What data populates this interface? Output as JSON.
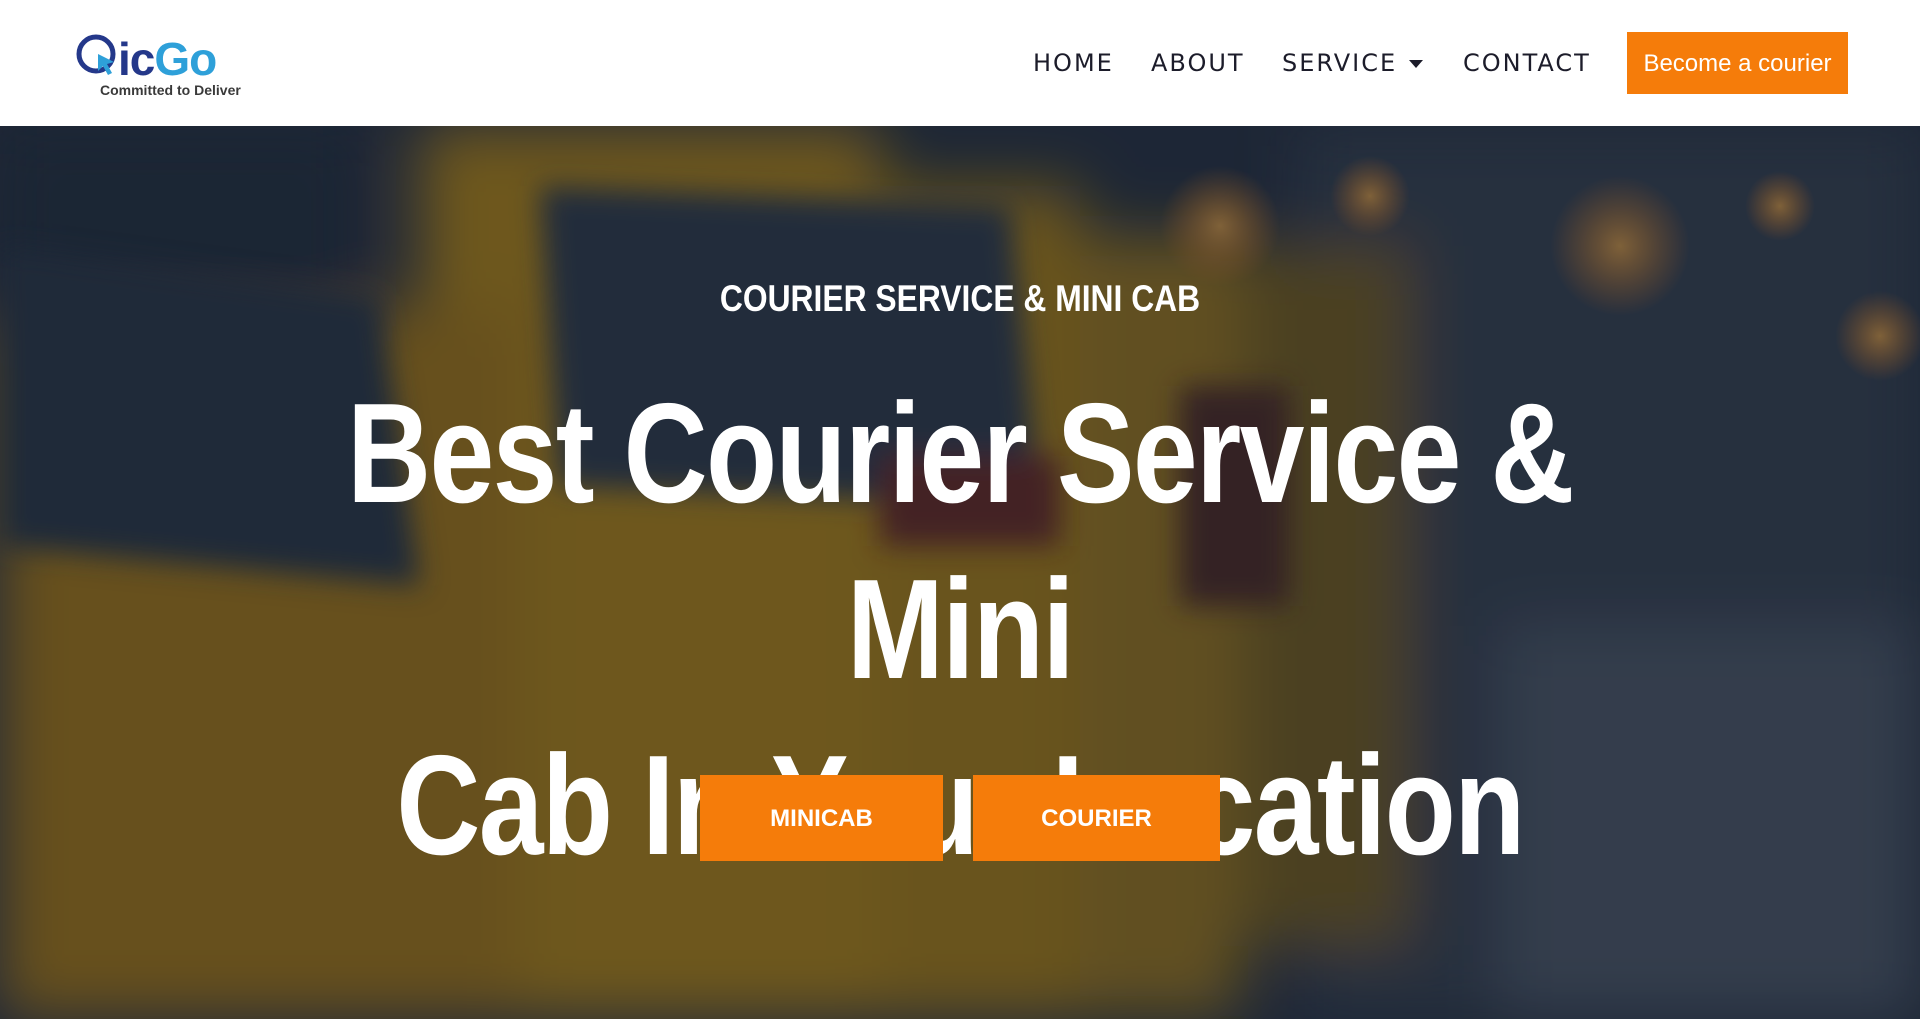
{
  "brand": {
    "logo_text_ic": "icGo",
    "tagline": "Committed to Deliver"
  },
  "nav": {
    "items": [
      {
        "label": "HOME"
      },
      {
        "label": "ABOUT"
      },
      {
        "label": "SERVICE"
      },
      {
        "label": "CONTACT"
      }
    ],
    "cta_label": "Become a courier"
  },
  "hero": {
    "kicker": "COURIER SERVICE & MINI CAB",
    "title_line1": "Best Courier Service & Mini",
    "title_line2": "Cab In Your Location",
    "buttons": [
      {
        "label": "MINICAB"
      },
      {
        "label": "COURIER"
      }
    ]
  },
  "colors": {
    "accent": "#f57c0a",
    "brand_dark_blue": "#24388a",
    "brand_light_blue": "#2ea0d9",
    "nav_text": "#1c1c2a"
  },
  "icons": {
    "logo_mark": "cursor-q-icon",
    "service_dropdown": "caret-down-icon"
  }
}
